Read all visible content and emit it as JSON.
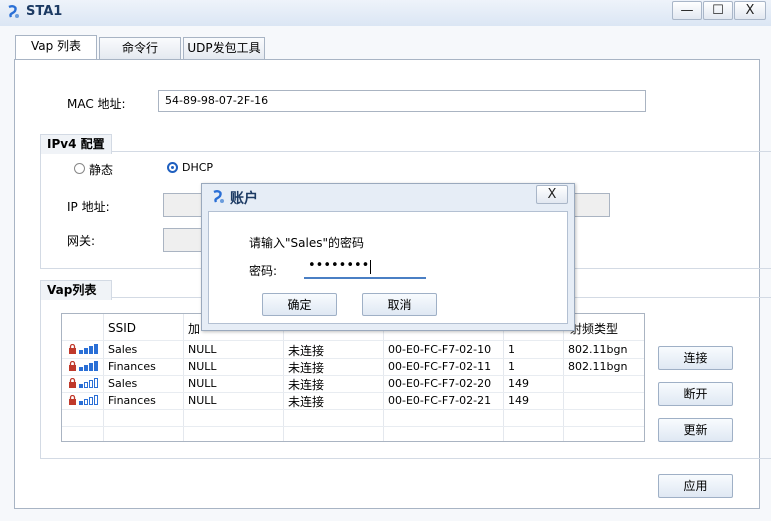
{
  "window": {
    "title": "STA1",
    "minimize": "—",
    "maximize": "☐",
    "close": "X"
  },
  "tabs": [
    {
      "label": "Vap 列表"
    },
    {
      "label": "命令行"
    },
    {
      "label": "UDP发包工具"
    }
  ],
  "mac": {
    "label": "MAC 地址:",
    "value": "54-89-98-07-2F-16"
  },
  "ipv4": {
    "group_title": "IPv4 配置",
    "static_label": "静态",
    "dhcp_label": "DHCP",
    "ip_label": "IP 地址:",
    "gateway_label": "网关:"
  },
  "vap": {
    "group_title": "Vap列表",
    "columns": [
      "",
      "SSID",
      "加",
      "",
      "",
      "",
      "射频类型"
    ],
    "rows": [
      {
        "ssid": "Sales",
        "enc": "NULL",
        "status": "未连接",
        "mac": "00-E0-FC-F7-02-10",
        "channel": "1",
        "radio": "802.11bgn"
      },
      {
        "ssid": "Finances",
        "enc": "NULL",
        "status": "未连接",
        "mac": "00-E0-FC-F7-02-11",
        "channel": "1",
        "radio": "802.11bgn"
      },
      {
        "ssid": "Sales",
        "enc": "NULL",
        "status": "未连接",
        "mac": "00-E0-FC-F7-02-20",
        "channel": "149",
        "radio": ""
      },
      {
        "ssid": "Finances",
        "enc": "NULL",
        "status": "未连接",
        "mac": "00-E0-FC-F7-02-21",
        "channel": "149",
        "radio": ""
      }
    ],
    "connect": "连接",
    "disconnect": "断开",
    "refresh": "更新"
  },
  "apply": "应用",
  "dialog": {
    "title": "账户",
    "close": "X",
    "prompt": "请输入\"Sales\"的密码",
    "password_label": "密码:",
    "password_value": "••••••••",
    "ok": "确定",
    "cancel": "取消"
  },
  "colors": {
    "accent": "#1f5fbf",
    "signal": "#2a6fd6",
    "lock": "#c0392b"
  }
}
